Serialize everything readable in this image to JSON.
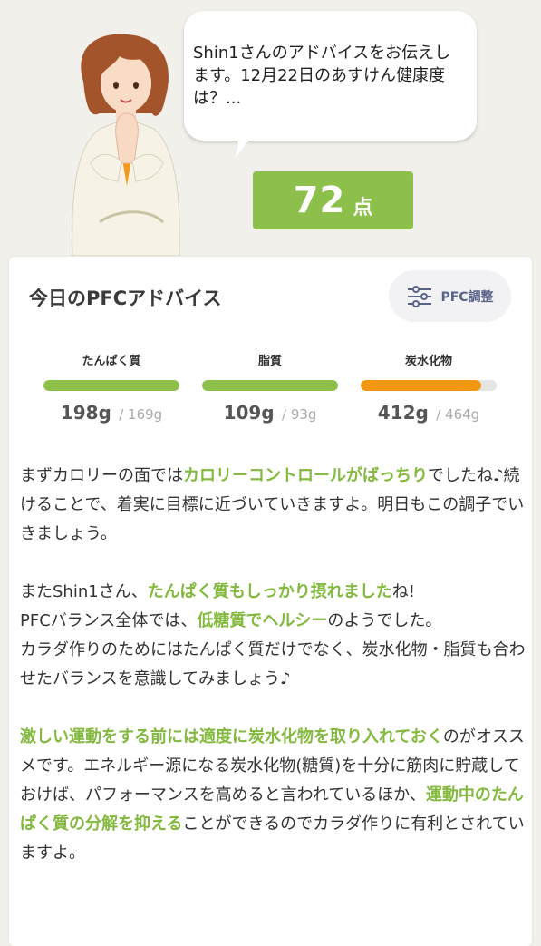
{
  "bubble": {
    "message": "Shin1さんのアドバイスをお伝えします。12月22日のあすけん健康度は？..."
  },
  "score": {
    "value": "72",
    "unit": "点"
  },
  "card": {
    "title": "今日のPFCアドバイス",
    "pfc_button_label": "PFC調整"
  },
  "macros": [
    {
      "label": "たんぱく質",
      "value": "198g",
      "target": "/ 169g",
      "fill": 1.0,
      "color": "#8dc04b"
    },
    {
      "label": "脂質",
      "value": "109g",
      "target": "/ 93g",
      "fill": 1.0,
      "color": "#8dc04b"
    },
    {
      "label": "炭水化物",
      "value": "412g",
      "target": "/ 464g",
      "fill": 0.888,
      "color": "#f29712"
    }
  ],
  "advice": {
    "p1": {
      "t1": "まずカロリーの面では",
      "h1": "カロリーコントロールがばっちり",
      "t2": "でしたね♪続けることで、着実に目標に近づいていきますよ。明日もこの調子でいきましょう。"
    },
    "p2": {
      "t1": "またShin1さん、",
      "h1": "たんぱく質もしっかり摂れました",
      "t2": "ね!",
      "t3": "PFCバランス全体では、",
      "h2": "低糖質でヘルシー",
      "t4": "のようでした。",
      "t5": "カラダ作りのためにはたんぱく質だけでなく、炭水化物・脂質も合わせたバランスを意識してみましょう♪"
    },
    "p3": {
      "h1": "激しい運動をする前には適度に炭水化物を取り入れておく",
      "t1": "のがオススメです。エネルギー源になる炭水化物(糖質)を十分に筋肉に貯蔵しておけば、パフォーマンスを高めると言われているほか、",
      "h2": "運動中のたんぱく質の分解を抑える",
      "t2": "ことができるのでカラダ作りに有利とされていますよ。"
    }
  },
  "colors": {
    "accent_green": "#8dc04b",
    "highlight_green": "#83b93f",
    "carb_orange": "#f29712",
    "background": "#f2f0ea"
  }
}
